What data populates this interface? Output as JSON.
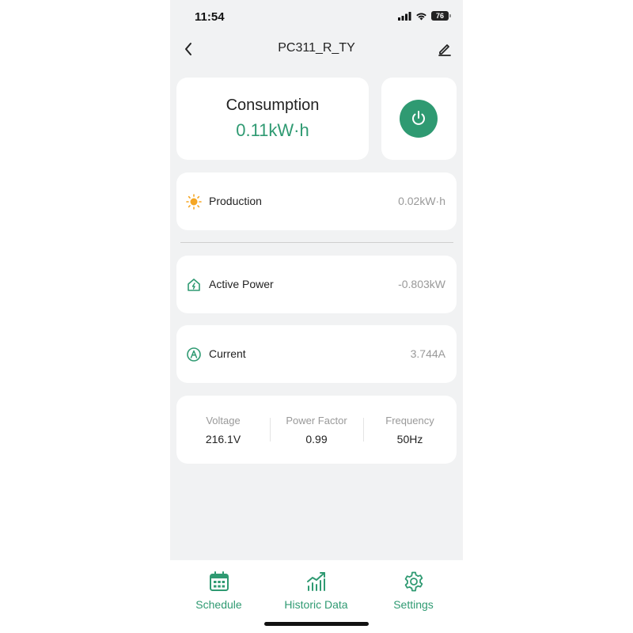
{
  "status_bar": {
    "time": "11:54",
    "battery": "76"
  },
  "header": {
    "title": "PC311_R_TY"
  },
  "consumption": {
    "title": "Consumption",
    "value": "0.11kW·h"
  },
  "rows": [
    {
      "label": "Production",
      "value": "0.02kW·h",
      "icon": "sun-icon"
    },
    {
      "label": "Active Power",
      "value": "-0.803kW",
      "icon": "home-power-icon"
    },
    {
      "label": "Current",
      "value": "3.744A",
      "icon": "ampere-icon"
    }
  ],
  "stats": [
    {
      "label": "Voltage",
      "value": "216.1V"
    },
    {
      "label": "Power Factor",
      "value": "0.99"
    },
    {
      "label": "Frequency",
      "value": "50Hz"
    }
  ],
  "tabs": [
    {
      "label": "Schedule",
      "icon": "calendar-icon"
    },
    {
      "label": "Historic Data",
      "icon": "chart-icon"
    },
    {
      "label": "Settings",
      "icon": "gear-icon"
    }
  ],
  "colors": {
    "accent": "#2f9a72",
    "background": "#f1f2f3",
    "sun": "#f5a623"
  }
}
